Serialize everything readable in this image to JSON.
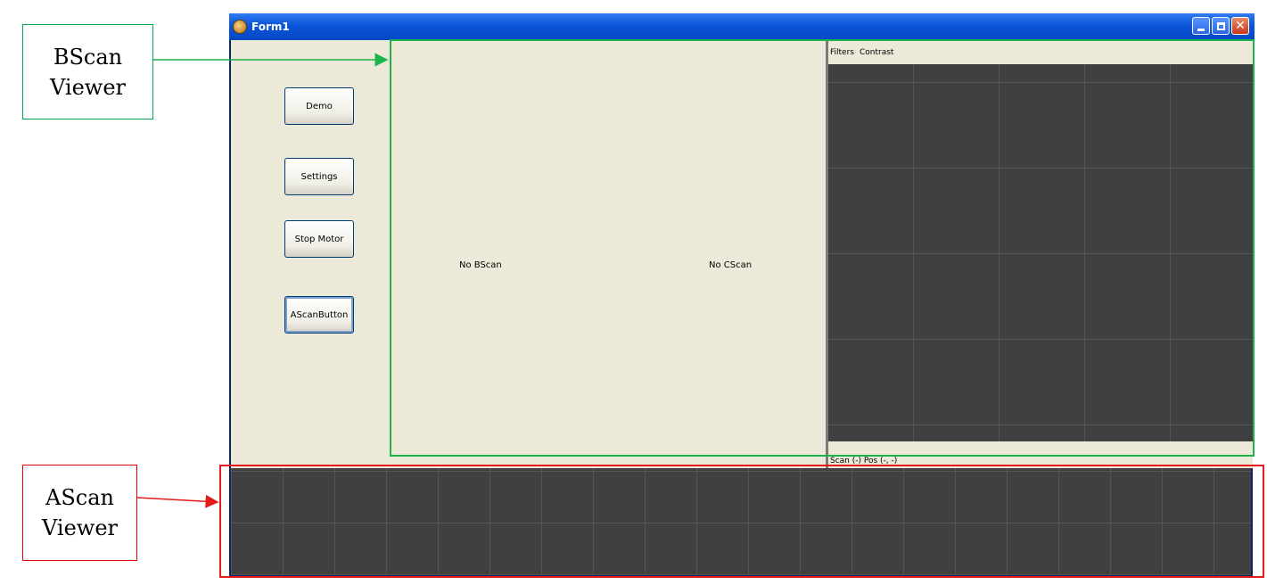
{
  "window": {
    "title": "Form1"
  },
  "buttons": {
    "demo": "Demo",
    "settings": "Settings",
    "stop_motor": "Stop Motor",
    "ascan": "AScanButton"
  },
  "bscan": {
    "no_bscan_text": "No BScan",
    "no_cscan_text": "No CScan"
  },
  "cscan": {
    "menu": [
      "Filters",
      "Contrast"
    ],
    "status": "Scan (-)  Pos (-, -)"
  },
  "annotations": {
    "bscan_label": [
      "BScan",
      "Viewer"
    ],
    "ascan_label": [
      "AScan",
      "Viewer"
    ]
  },
  "colors": {
    "bscan_highlight": "#1db34b",
    "ascan_highlight": "#e31b1b",
    "viewer_bg": "#404040",
    "titlebar": "#0a55d8"
  }
}
